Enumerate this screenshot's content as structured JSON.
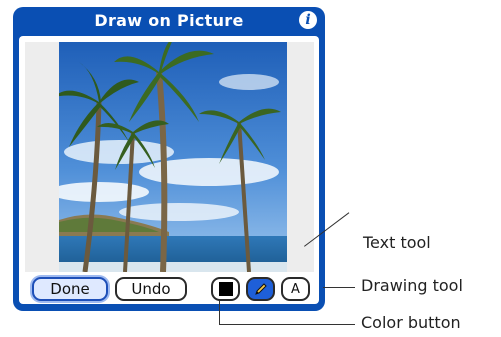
{
  "window": {
    "title": "Draw on Picture"
  },
  "header": {
    "info_icon": "info-icon"
  },
  "toolbar": {
    "done_label": "Done",
    "undo_label": "Undo",
    "color_button_color": "#000000",
    "drawing_tool_icon": "pencil-icon",
    "text_tool_label": "A"
  },
  "annotations": {
    "text_tool": "Text tool",
    "drawing_tool": "Drawing tool",
    "color_button": "Color button"
  },
  "colors": {
    "frame": "#0a4fb3",
    "selected_tool": "#1e5fd8"
  }
}
